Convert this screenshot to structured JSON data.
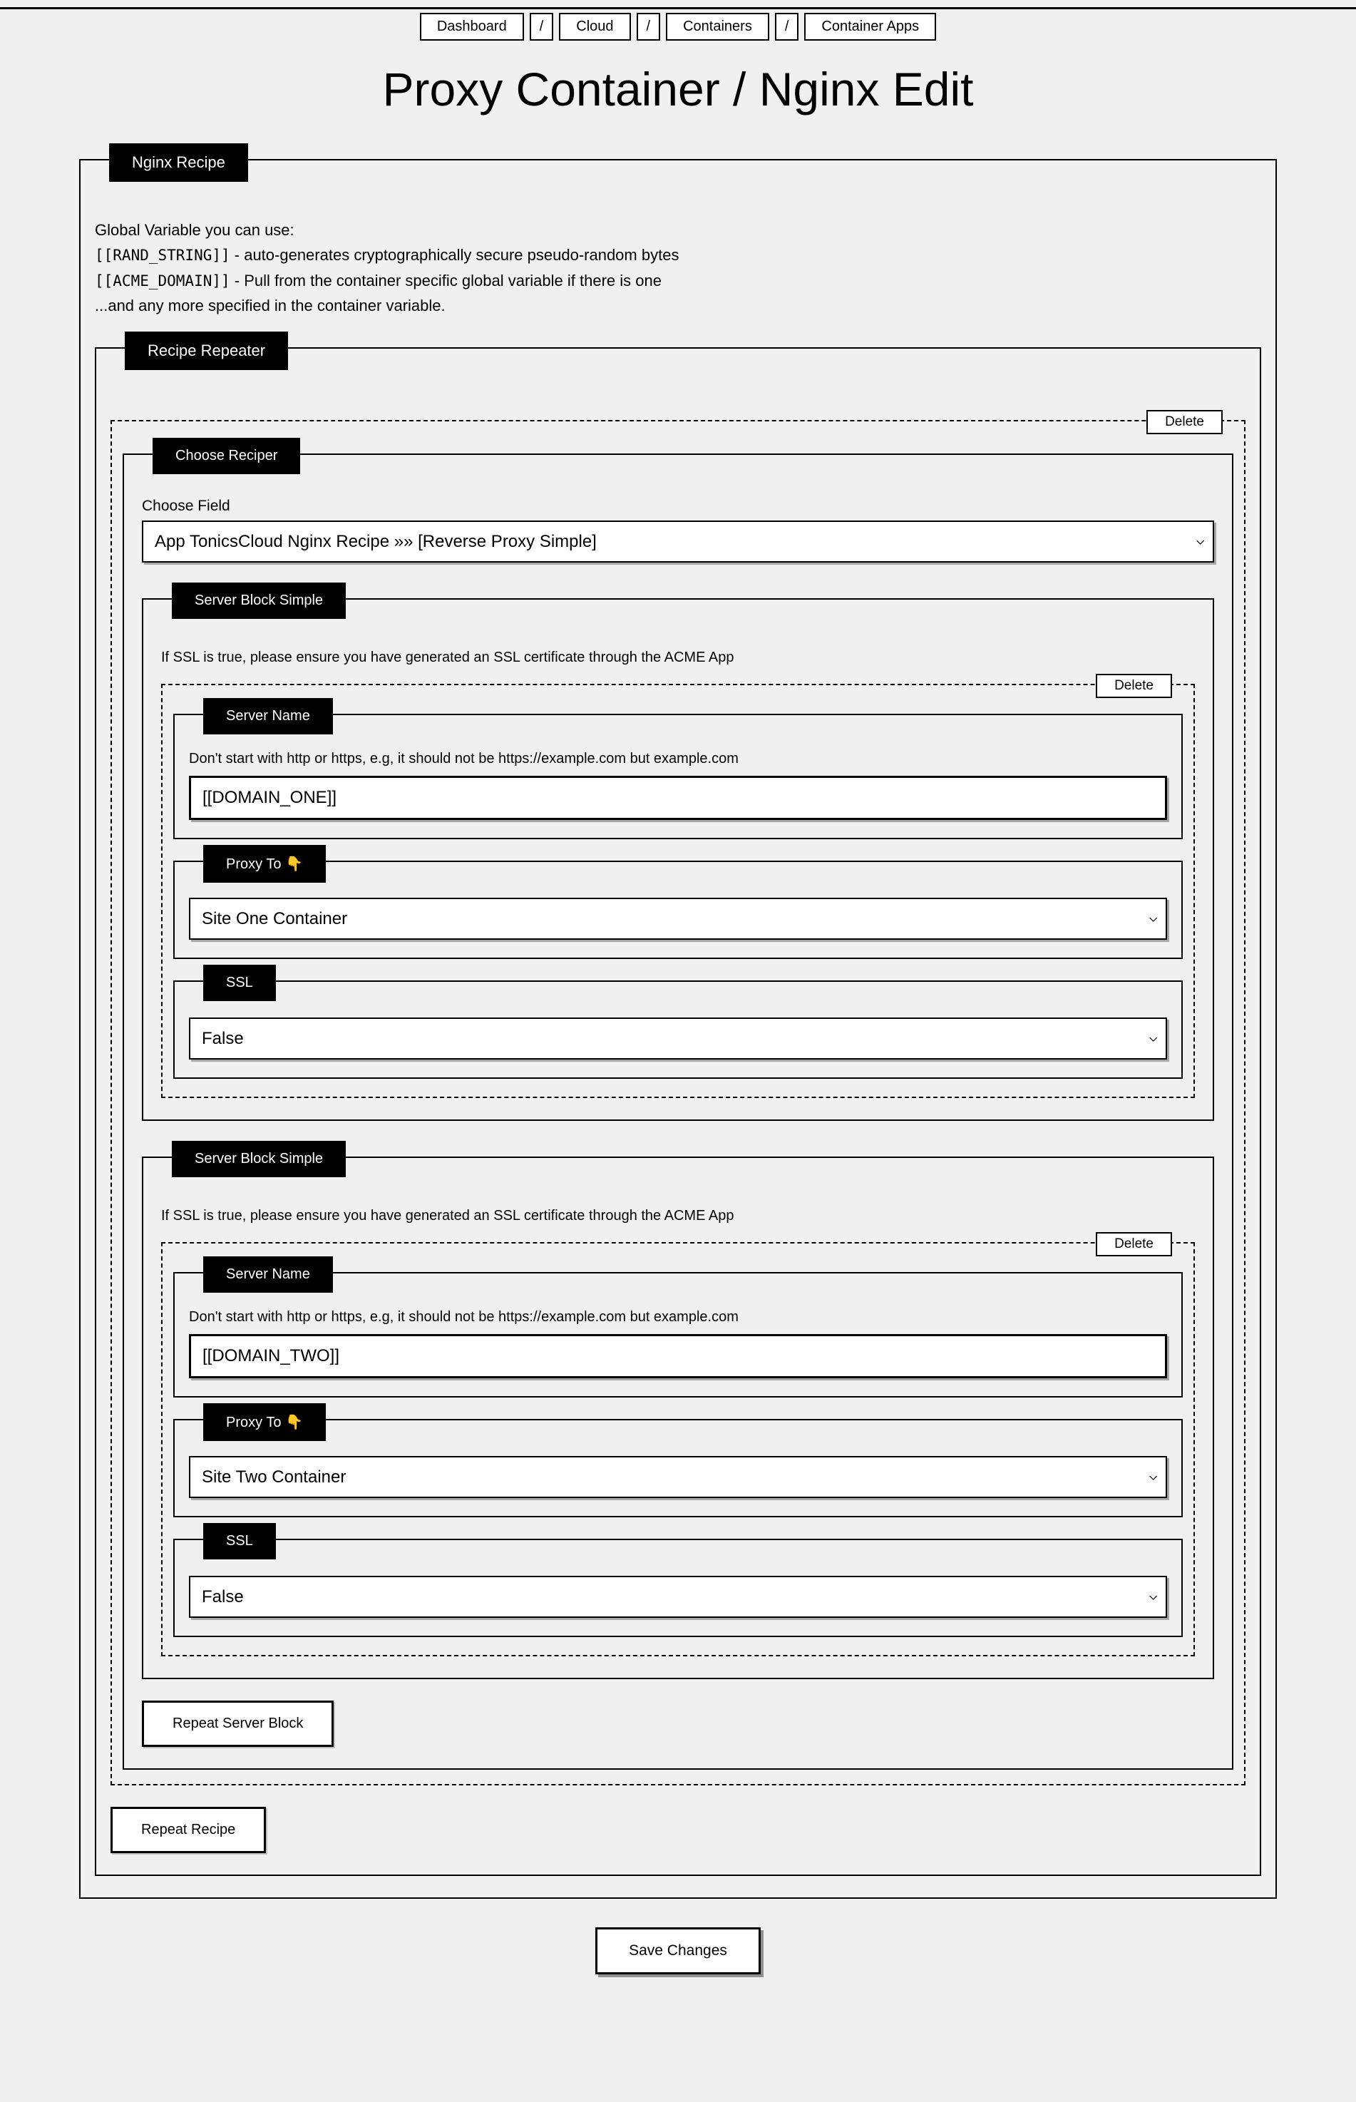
{
  "breadcrumb": {
    "items": [
      "Dashboard",
      "Cloud",
      "Containers",
      "Container Apps"
    ],
    "separator": "/"
  },
  "pageTitle": "Proxy Container / Nginx Edit",
  "nginxRecipe": {
    "legend": "Nginx Recipe",
    "infoLine1": "Global Variable you can use:",
    "infoRand": "[[RAND_STRING]]",
    "infoRandDesc": " - auto-generates cryptographically secure pseudo-random bytes",
    "infoAcme": "[[ACME_DOMAIN]]",
    "infoAcmeDesc": " - Pull from the container specific global variable if there is one",
    "infoLine4": "...and any more specified in the container variable."
  },
  "recipeRepeater": {
    "legend": "Recipe Repeater",
    "deleteLabel": "Delete",
    "chooseRecipe": {
      "legend": "Choose Reciper",
      "fieldLabel": "Choose Field",
      "fieldValue": "App TonicsCloud Nginx Recipe »» [Reverse Proxy Simple]"
    },
    "serverBlocks": [
      {
        "legend": "Server Block Simple",
        "sslHint": "If SSL is true, please ensure you have generated an SSL certificate through the ACME App",
        "deleteLabel": "Delete",
        "serverName": {
          "legend": "Server Name",
          "hint": "Don't start with http or https, e.g, it should not be https://example.com but example.com",
          "value": "[[DOMAIN_ONE]]"
        },
        "proxyTo": {
          "legend": "Proxy To 👇",
          "value": "Site One Container"
        },
        "ssl": {
          "legend": "SSL",
          "value": "False"
        }
      },
      {
        "legend": "Server Block Simple",
        "sslHint": "If SSL is true, please ensure you have generated an SSL certificate through the ACME App",
        "deleteLabel": "Delete",
        "serverName": {
          "legend": "Server Name",
          "hint": "Don't start with http or https, e.g, it should not be https://example.com but example.com",
          "value": "[[DOMAIN_TWO]]"
        },
        "proxyTo": {
          "legend": "Proxy To 👇",
          "value": "Site Two Container"
        },
        "ssl": {
          "legend": "SSL",
          "value": "False"
        }
      }
    ],
    "repeatServerBlockLabel": "Repeat Server Block",
    "repeatRecipeLabel": "Repeat Recipe"
  },
  "saveChangesLabel": "Save Changes"
}
